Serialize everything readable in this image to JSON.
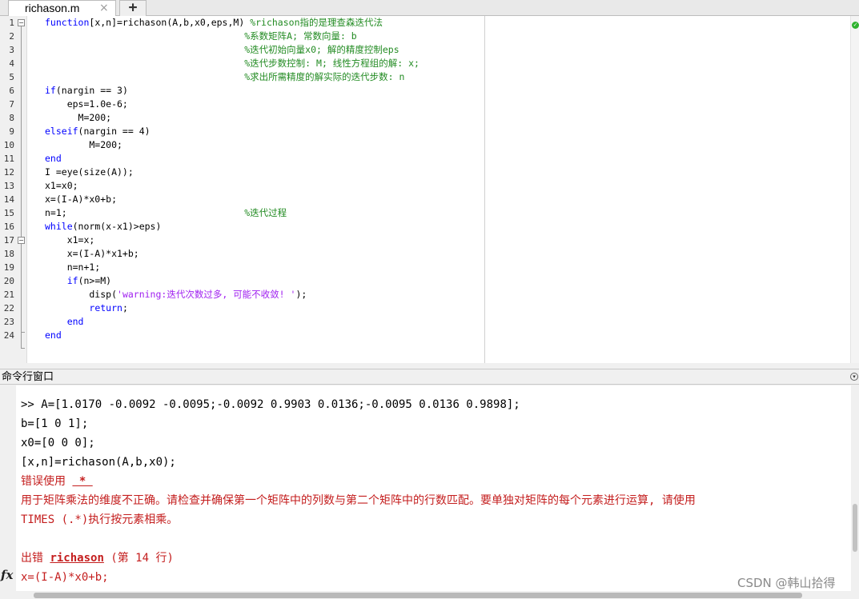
{
  "tabs": [
    {
      "label": "richason.m",
      "close_icon": "×"
    }
  ],
  "new_tab_label": "+",
  "editor": {
    "line_numbers": [
      "1",
      "2",
      "3",
      "4",
      "5",
      "6",
      "7",
      "8",
      "9",
      "10",
      "11",
      "12",
      "13",
      "14",
      "15",
      "16",
      "17",
      "18",
      "19",
      "20",
      "21",
      "22",
      "23",
      "24"
    ],
    "lines": [
      [
        [
          "kw",
          "function"
        ],
        [
          "",
          "[x,n]=richason(A,b,x0,eps,M) "
        ],
        [
          "cm",
          "%richason指的是理查森迭代法"
        ]
      ],
      [
        [
          "",
          "                                    "
        ],
        [
          "cm",
          "%系数矩阵A; 常数向量: b"
        ]
      ],
      [
        [
          "",
          "                                    "
        ],
        [
          "cm",
          "%迭代初始向量x0; 解的精度控制eps"
        ]
      ],
      [
        [
          "",
          "                                    "
        ],
        [
          "cm",
          "%迭代步数控制: M; 线性方程组的解: x;"
        ]
      ],
      [
        [
          "",
          "                                    "
        ],
        [
          "cm",
          "%求出所需精度的解实际的迭代步数: n"
        ]
      ],
      [
        [
          "kw",
          "if"
        ],
        [
          "",
          "(nargin == 3)"
        ]
      ],
      [
        [
          "",
          "    eps=1.0e-6;"
        ]
      ],
      [
        [
          "",
          "      M=200;"
        ]
      ],
      [
        [
          "kw",
          "elseif"
        ],
        [
          "",
          "(nargin == 4)"
        ]
      ],
      [
        [
          "",
          "        M=200;"
        ]
      ],
      [
        [
          "kw",
          "end"
        ]
      ],
      [
        [
          "",
          "I =eye(size(A));"
        ]
      ],
      [
        [
          "",
          "x1=x0;"
        ]
      ],
      [
        [
          "",
          "x=(I-A)*x0+b;"
        ]
      ],
      [
        [
          "",
          "n=1;                                "
        ],
        [
          "cm",
          "%迭代过程"
        ]
      ],
      [
        [
          "kw",
          "while"
        ],
        [
          "",
          "(norm(x-x1)>eps)"
        ]
      ],
      [
        [
          "",
          "    x1=x;"
        ]
      ],
      [
        [
          "",
          "    x=(I-A)*x1+b;"
        ]
      ],
      [
        [
          "",
          "    n=n+1;"
        ]
      ],
      [
        [
          "",
          "    "
        ],
        [
          "kw",
          "if"
        ],
        [
          "",
          "(n>=M)"
        ]
      ],
      [
        [
          "",
          "        disp("
        ],
        [
          "st",
          "'warning:迭代次数过多, 可能不收敛! '"
        ],
        [
          "",
          ");"
        ]
      ],
      [
        [
          "",
          "        "
        ],
        [
          "kw",
          "return"
        ],
        [
          "",
          ";"
        ]
      ],
      [
        [
          "",
          "    "
        ],
        [
          "kw",
          "end"
        ]
      ],
      [
        [
          "kw",
          "end"
        ]
      ]
    ]
  },
  "command_window": {
    "title": "命令行窗口",
    "fx_icon": "fx",
    "lines": [
      [
        [
          "",
          ">> A=[1.0170 -0.0092 -0.0095;-0.0092 0.9903 0.0136;-0.0095 0.0136 0.9898];"
        ]
      ],
      [
        [
          "",
          "b=[1 0 1];"
        ]
      ],
      [
        [
          "",
          "x0=[0 0 0];"
        ]
      ],
      [
        [
          "",
          "[x,n]=richason(A,b,x0);"
        ]
      ],
      [
        [
          "err",
          "错误使用 "
        ],
        [
          "errlink",
          " * "
        ]
      ],
      [
        [
          "err",
          "用于矩阵乘法的维度不正确。请检查并确保第一个矩阵中的列数与第二个矩阵中的行数匹配。要单独对矩阵的每个元素进行运算, 请使用"
        ]
      ],
      [
        [
          "err",
          "TIMES (.*)执行按元素相乘。"
        ]
      ],
      [
        [
          "",
          ""
        ]
      ],
      [
        [
          "err",
          "出错 "
        ],
        [
          "errlink",
          "richason"
        ],
        [
          "err",
          " (第 14 行)"
        ]
      ],
      [
        [
          "err",
          "x=(I-A)*x0+b;"
        ]
      ]
    ]
  },
  "watermark": "CSDN @韩山拾得",
  "colors": {
    "keyword": "#0000ff",
    "comment": "#228b22",
    "string": "#a020f0",
    "error": "#c41e1e"
  }
}
